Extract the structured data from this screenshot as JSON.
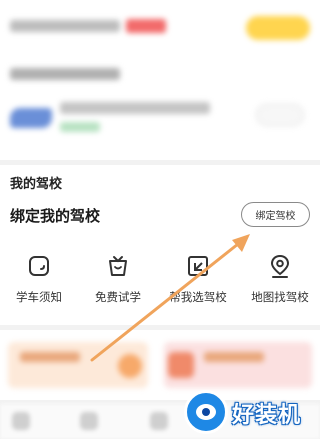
{
  "my_school": {
    "section_title": "我的驾校",
    "bind_title": "绑定我的驾校",
    "bind_button_label": "绑定驾校"
  },
  "quick_actions": [
    {
      "label": "学车须知",
      "icon": "notice-icon"
    },
    {
      "label": "免费试学",
      "icon": "gift-icon"
    },
    {
      "label": "帮我选驾校",
      "icon": "select-icon"
    },
    {
      "label": "地图找驾校",
      "icon": "map-pin-icon"
    }
  ],
  "watermark": {
    "text": "好装机"
  },
  "colors": {
    "accent_arrow": "#f0a45c",
    "watermark_blue": "#1e88e5",
    "blurred_banner_yellow": "#ffd54f"
  }
}
